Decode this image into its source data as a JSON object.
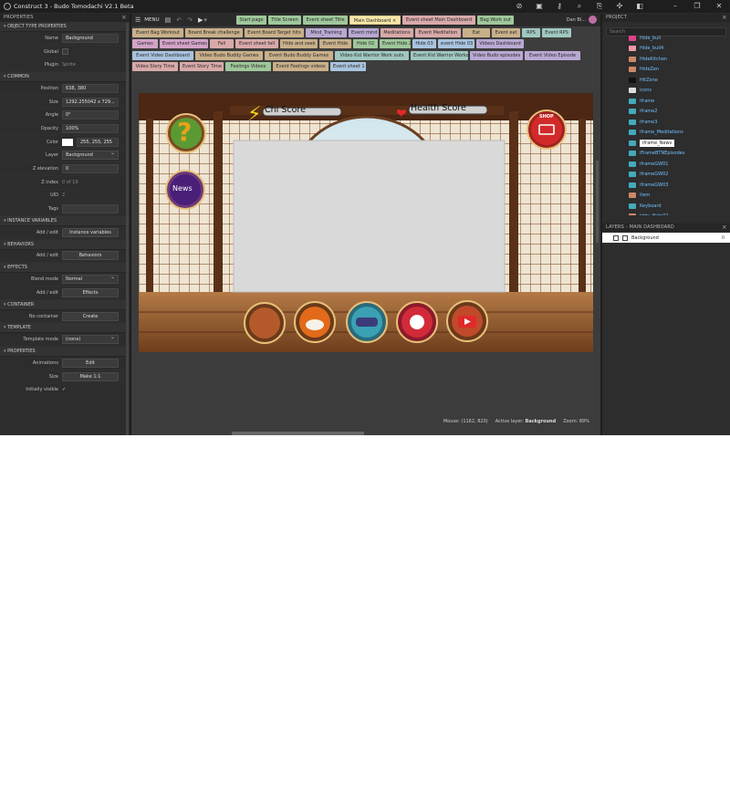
{
  "window": {
    "title": "Construct 3 - Budo Tomodachi V2.1 Beta"
  },
  "properties_panel": {
    "header": "PROPERTIES",
    "sections": [
      {
        "title": "OBJECT TYPE PROPERTIES",
        "rows": [
          {
            "label": "Name",
            "kind": "input",
            "value": "Background"
          },
          {
            "label": "Global",
            "kind": "checkbox",
            "value": ""
          },
          {
            "label": "Plugin",
            "kind": "text",
            "value": "Sprite"
          }
        ]
      },
      {
        "title": "COMMON",
        "rows": [
          {
            "label": "Position",
            "kind": "input",
            "value": "638, 380"
          },
          {
            "label": "Size",
            "kind": "input",
            "value": "1292.255042 x 729..."
          },
          {
            "label": "Angle",
            "kind": "input",
            "value": "0°"
          },
          {
            "label": "Opacity",
            "kind": "input",
            "value": "100%"
          },
          {
            "label": "Color",
            "kind": "color",
            "value": "255, 255, 255"
          },
          {
            "label": "Layer",
            "kind": "select",
            "value": "Background"
          },
          {
            "label": "Z elevation",
            "kind": "input",
            "value": "0"
          },
          {
            "label": "Z index",
            "kind": "text",
            "value": "0 of 19"
          },
          {
            "label": "UID",
            "kind": "text",
            "value": "2"
          },
          {
            "label": "Tags",
            "kind": "input",
            "value": ""
          }
        ]
      },
      {
        "title": "INSTANCE VARIABLES",
        "rows": [
          {
            "label": "Add / edit",
            "kind": "button",
            "value": "Instance variables"
          }
        ]
      },
      {
        "title": "BEHAVIORS",
        "rows": [
          {
            "label": "Add / edit",
            "kind": "button",
            "value": "Behaviors"
          }
        ]
      },
      {
        "title": "EFFECTS",
        "rows": [
          {
            "label": "Blend mode",
            "kind": "select",
            "value": "Normal"
          },
          {
            "label": "Add / edit",
            "kind": "button",
            "value": "Effects"
          }
        ]
      },
      {
        "title": "CONTAINER",
        "rows": [
          {
            "label": "No container",
            "kind": "button",
            "value": "Create"
          }
        ]
      },
      {
        "title": "TEMPLATE",
        "rows": [
          {
            "label": "Template mode",
            "kind": "select",
            "value": "(none)"
          }
        ]
      },
      {
        "title": "PROPERTIES",
        "rows": [
          {
            "label": "Animations",
            "kind": "button",
            "value": "Edit"
          },
          {
            "label": "Size",
            "kind": "button",
            "value": "Make 1:1"
          },
          {
            "label": "Initially visible",
            "kind": "check-on",
            "value": "✓"
          }
        ]
      }
    ]
  },
  "toolbar": {
    "menu_label": "MENU",
    "user_name": "Dan Bl..."
  },
  "tabs": [
    {
      "label": "Start page",
      "color": "#9fc79a",
      "row": 0
    },
    {
      "label": "Title Screen",
      "color": "#9fc79a",
      "row": 0
    },
    {
      "label": "Event sheet Title",
      "color": "#9fc79a",
      "row": 0
    },
    {
      "label": "Main Dashboard ×",
      "color": "#f6e7a8",
      "row": 0
    },
    {
      "label": "Event sheet Main Dashboard",
      "color": "#d9a9a9",
      "row": 0
    },
    {
      "label": "Bag Work out",
      "color": "#9fc79a",
      "row": 0
    },
    {
      "label": "Event Bag Workout",
      "color": "#c9b08a",
      "row": 1
    },
    {
      "label": "Board Break challenge",
      "color": "#c9b08a",
      "row": 1
    },
    {
      "label": "Event Board Target hits",
      "color": "#c9b08a",
      "row": 1
    },
    {
      "label": "Mind_Training",
      "color": "#b9a9d3",
      "row": 1
    },
    {
      "label": "Event mind",
      "color": "#b9a9d3",
      "row": 1
    },
    {
      "label": "Meditations",
      "color": "#d9a9a9",
      "row": 1
    },
    {
      "label": "Event Meditation",
      "color": "#d9a9a9",
      "row": 1
    },
    {
      "label": "Eat",
      "color": "#c9b08a",
      "row": 1
    },
    {
      "label": "Event eat",
      "color": "#c9b08a",
      "row": 1
    },
    {
      "label": "RPS",
      "color": "#9fc7c0",
      "row": 1
    },
    {
      "label": "Event RPS",
      "color": "#9fc7c0",
      "row": 1
    },
    {
      "label": "Games",
      "color": "#d2a3c8",
      "row": 2
    },
    {
      "label": "Event sheet Games",
      "color": "#d2a3c8",
      "row": 2
    },
    {
      "label": "Fall",
      "color": "#d9a9a9",
      "row": 2
    },
    {
      "label": "Event sheet fall",
      "color": "#d9a9a9",
      "row": 2
    },
    {
      "label": "Hide and seek",
      "color": "#c9b08a",
      "row": 2
    },
    {
      "label": "Event Hide",
      "color": "#c9b08a",
      "row": 2
    },
    {
      "label": "Hide 02",
      "color": "#9fc79a",
      "row": 2
    },
    {
      "label": "Event Hide 2",
      "color": "#9fc79a",
      "row": 2
    },
    {
      "label": "Hide 03",
      "color": "#a9c3de",
      "row": 2
    },
    {
      "label": "event Hide 03",
      "color": "#a9c3de",
      "row": 2
    },
    {
      "label": "Videos Dashboard",
      "color": "#b9a9d3",
      "row": 2
    },
    {
      "label": "Event Video Dashboard",
      "color": "#a9c3de",
      "row": 3
    },
    {
      "label": "Video Budo Buddy Games",
      "color": "#c9b08a",
      "row": 3
    },
    {
      "label": "Event Budo Buddy Games",
      "color": "#c9b08a",
      "row": 3
    },
    {
      "label": "Video Kid Warrior Work outs",
      "color": "#9fc7c0",
      "row": 3
    },
    {
      "label": "Event Kid Warrior Workouts",
      "color": "#9fc7c0",
      "row": 3
    },
    {
      "label": "Video Budo episodes",
      "color": "#b9a9d3",
      "row": 3
    },
    {
      "label": "Event Video Episode",
      "color": "#b9a9d3",
      "row": 3
    },
    {
      "label": "Video Story Time",
      "color": "#d9a9a9",
      "row": 4
    },
    {
      "label": "Event Story Time",
      "color": "#d9a9a9",
      "row": 4
    },
    {
      "label": "Feelings Videos",
      "color": "#9fc79a",
      "row": 4
    },
    {
      "label": "Event Feelings videos",
      "color": "#c9b08a",
      "row": 4
    },
    {
      "label": "Event sheet 1",
      "color": "#a9c3de",
      "row": 4
    }
  ],
  "scene": {
    "chi_label": "Chi Score",
    "health_label": "Health Score",
    "news_label": "News",
    "shop_label": "SHOP",
    "help_glyph": "?"
  },
  "status_bar": {
    "mouse": "Mouse: (1162, 820)",
    "active_layer_label": "Active layer:",
    "active_layer": "Background",
    "zoom": "Zoom: 89%"
  },
  "project_panel": {
    "header": "PROJECT",
    "search_placeholder": "Search",
    "items": [
      {
        "name": "Hide_bull",
        "color": "#d48"
      },
      {
        "name": "Hide_bull4",
        "color": "#e9a"
      },
      {
        "name": "HideKitchen",
        "color": "#c86"
      },
      {
        "name": "HideZen",
        "color": "#c86"
      },
      {
        "name": "HitZone",
        "color": "#111"
      },
      {
        "name": "icons",
        "color": "#ddd"
      },
      {
        "name": "iframe",
        "color": "#4ab"
      },
      {
        "name": "iframe2",
        "color": "#4ab"
      },
      {
        "name": "iframe3",
        "color": "#4ab"
      },
      {
        "name": "iframe_Meditations",
        "color": "#4ab"
      },
      {
        "name": "iframe_News",
        "color": "#4ab"
      },
      {
        "name": "iFrameBTNEpisodes",
        "color": "#4ab"
      },
      {
        "name": "iframeGW01",
        "color": "#4ab"
      },
      {
        "name": "iframeGW02",
        "color": "#4ab"
      },
      {
        "name": "iframeGW03",
        "color": "#4ab"
      },
      {
        "name": "item",
        "color": "#c86"
      },
      {
        "name": "Keyboard",
        "color": "#4ab"
      },
      {
        "name": "kitty_Hide02",
        "color": "#c86"
      }
    ],
    "selected_index": 10
  },
  "layers_panel": {
    "header": "LAYERS - MAIN DASHBOARD",
    "layers": [
      {
        "name": "Background",
        "z": "0"
      }
    ]
  },
  "colors": {
    "accent": "#6fc0ff",
    "panel": "#2d2d2d"
  }
}
